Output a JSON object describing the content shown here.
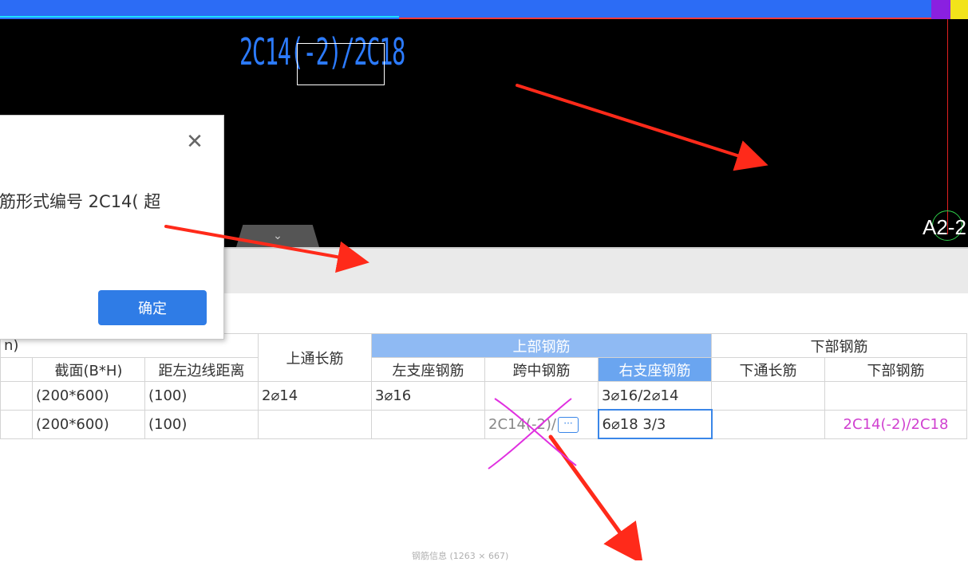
{
  "cad": {
    "rebar_text": "2C14(-2)/2C18",
    "axis_label": "A2-2"
  },
  "dialog": {
    "close_glyph": "✕",
    "message": "筋形式编号 2C14( 超",
    "ok_label": "确定"
  },
  "collapse_tab": {
    "glyph": "⌄"
  },
  "table": {
    "group_left_partial": "n)",
    "header_top_reinf": "上通长筋",
    "group_upper": "上部钢筋",
    "group_lower": "下部钢筋",
    "cols": {
      "section": "截面(B*H)",
      "offset": "距左边线距离",
      "left_support": "左支座钢筋",
      "mid_span": "跨中钢筋",
      "right_support": "右支座钢筋",
      "bottom_through": "下通长筋",
      "bottom_reinf": "下部钢筋"
    },
    "rows": [
      {
        "section": "(200*600)",
        "offset": "(100)",
        "top_through": "2⌀14",
        "left_support": "3⌀16",
        "mid_span": "",
        "right_support": "3⌀16/2⌀14",
        "bottom_through": "",
        "bottom_reinf": ""
      },
      {
        "section": "(200*600)",
        "offset": "(100)",
        "top_through": "",
        "left_support": "",
        "mid_span": "2C14(-2)/",
        "right_support": "6⌀18 3/3",
        "bottom_through": "",
        "bottom_reinf": "2C14(-2)/2C18"
      }
    ],
    "more_button": "···"
  },
  "footer": {
    "label": "钢筋信息 (1263 × 667)"
  },
  "colors": {
    "cad_text": "#2c7bff",
    "group_header": "#8fbaf3",
    "ok_button": "#2f7ce6",
    "annotation_red": "#ff2a1a",
    "annotation_magenta": "#d040d0"
  }
}
